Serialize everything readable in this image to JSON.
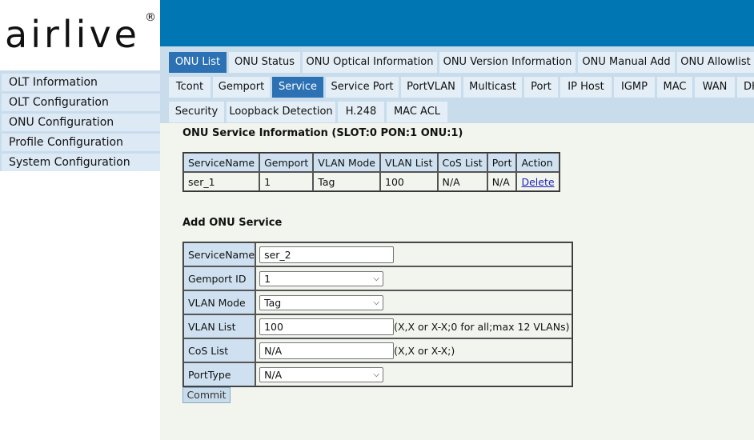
{
  "logo": {
    "text": "airlive",
    "reg": "®"
  },
  "sidebar": {
    "items": [
      {
        "label": "OLT Information"
      },
      {
        "label": "OLT Configuration"
      },
      {
        "label": "ONU Configuration"
      },
      {
        "label": "Profile Configuration"
      },
      {
        "label": "System Configuration"
      }
    ]
  },
  "tabs_row1": [
    {
      "label": "ONU List",
      "active": true
    },
    {
      "label": "ONU Status"
    },
    {
      "label": "ONU Optical Information"
    },
    {
      "label": "ONU Version Information"
    },
    {
      "label": "ONU Manual Add"
    },
    {
      "label": "ONU Allowlist"
    }
  ],
  "tabs_row2": [
    {
      "label": "Tcont"
    },
    {
      "label": "Gemport"
    },
    {
      "label": "Service",
      "active": true
    },
    {
      "label": "Service Port"
    },
    {
      "label": "PortVLAN"
    },
    {
      "label": "Multicast"
    },
    {
      "label": "Port"
    },
    {
      "label": "IP Host"
    },
    {
      "label": "IGMP"
    },
    {
      "label": "MAC"
    },
    {
      "label": "WAN"
    },
    {
      "label": "DH"
    }
  ],
  "tabs_row3": [
    {
      "label": "Security"
    },
    {
      "label": "Loopback Detection"
    },
    {
      "label": "H.248"
    },
    {
      "label": "MAC ACL"
    }
  ],
  "info": {
    "title": "ONU Service Information (SLOT:0 PON:1 ONU:1)",
    "headers": [
      "ServiceName",
      "Gemport",
      "VLAN Mode",
      "VLAN List",
      "CoS List",
      "Port",
      "Action"
    ],
    "row": {
      "service_name": "ser_1",
      "gemport": "1",
      "vlan_mode": "Tag",
      "vlan_list": "100",
      "cos_list": "N/A",
      "port": "N/A",
      "action": "Delete"
    }
  },
  "add": {
    "title": "Add ONU Service",
    "service_name_label": "ServiceName",
    "service_name_value": "ser_2",
    "gemport_label": "Gemport ID",
    "gemport_value": "1",
    "vlan_mode_label": "VLAN Mode",
    "vlan_mode_value": "Tag",
    "vlan_list_label": "VLAN List",
    "vlan_list_value": "100",
    "vlan_list_hint": "(X,X or X-X;0 for all;max 12 VLANs)",
    "cos_list_label": "CoS List",
    "cos_list_value": "N/A",
    "cos_list_hint": "(X,X or X-X;)",
    "port_type_label": "PortType",
    "port_type_value": "N/A",
    "commit_label": "Commit"
  },
  "colors": {
    "header_blue": "#0076b2",
    "tab_active": "#2b71b4",
    "tab_band": "#c8dcec",
    "content_bg": "#f2f5ee"
  }
}
